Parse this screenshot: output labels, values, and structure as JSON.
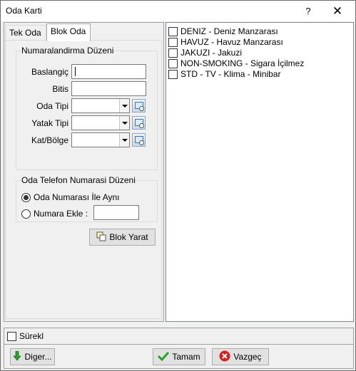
{
  "window": {
    "title": "Oda Karti",
    "help_label": "?",
    "close_label": "✕"
  },
  "tabs": [
    {
      "label": "Tek Oda",
      "active": false
    },
    {
      "label": "Blok Oda",
      "active": true
    }
  ],
  "numbering_group": {
    "title": "Numaralandirma Düzeni",
    "fields": {
      "start_label": "Baslangiç",
      "start_value": "",
      "end_label": "Bitis",
      "end_value": "",
      "room_type_label": "Oda Tipi",
      "room_type_value": "",
      "bed_type_label": "Yatak Tipi",
      "bed_type_value": "",
      "floor_label": "Kat/Bölge",
      "floor_value": ""
    }
  },
  "phone_group": {
    "title": "Oda Telefon Numarasi Düzeni",
    "options": [
      {
        "label": "Oda Numarası İle Aynı",
        "checked": true
      },
      {
        "label": "Numara Ekle :",
        "checked": false
      }
    ],
    "add_value": ""
  },
  "create_block_button": {
    "label": "Blok Yarat"
  },
  "features": [
    {
      "label": "DENIZ - Deniz Manzarası",
      "checked": false
    },
    {
      "label": "HAVUZ - Havuz Manzarası",
      "checked": false
    },
    {
      "label": "JAKUZI - Jakuzi",
      "checked": false
    },
    {
      "label": "NON-SMOKING - Sigara İçilmez",
      "checked": false
    },
    {
      "label": "STD - TV - Klima - Minibar",
      "checked": false
    }
  ],
  "continuous": {
    "label": "Sürekl",
    "checked": false
  },
  "footer_buttons": {
    "other_label": "Diger...",
    "ok_label": "Tamam",
    "cancel_label": "Vazgeç"
  },
  "colors": {
    "ok_icon": "#2e9e2e",
    "cancel_icon": "#d42020",
    "other_icon": "#2e9e2e"
  }
}
